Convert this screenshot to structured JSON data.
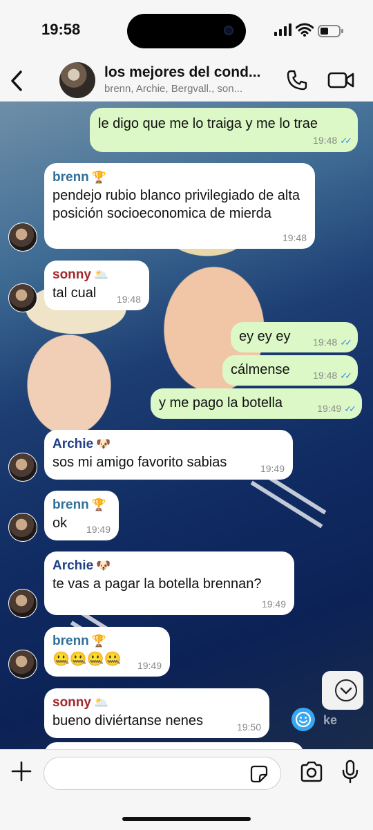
{
  "status_bar": {
    "time": "19:58"
  },
  "header": {
    "title": "los mejores del cond...",
    "subtitle": "brenn, Archie, Bergvall., son..."
  },
  "messages": [
    {
      "dir": "out",
      "text": "le digo que me lo traiga y me lo trae",
      "time": "19:48"
    },
    {
      "dir": "in",
      "sender": "brenn",
      "badge": "🏆",
      "text": "pendejo rubio blanco privilegiado de alta posición socioeconomica de mierda",
      "time": "19:48"
    },
    {
      "dir": "in",
      "sender": "sonny",
      "badge": "🌥️",
      "text": "tal cual",
      "time": "19:48"
    },
    {
      "dir": "out",
      "text": "ey ey ey",
      "time": "19:48"
    },
    {
      "dir": "out",
      "text": "cálmense",
      "time": "19:48"
    },
    {
      "dir": "out",
      "text": "y me pago la botella",
      "time": "19:49"
    },
    {
      "dir": "in",
      "sender": "Archie",
      "badge": "🐶",
      "text": "sos mi amigo favorito sabias",
      "time": "19:49"
    },
    {
      "dir": "in",
      "sender": "brenn",
      "badge": "🏆",
      "text": "ok",
      "time": "19:49"
    },
    {
      "dir": "in",
      "sender": "Archie",
      "badge": "🐶",
      "text": "te vas a pagar la botella brennan?",
      "time": "19:49"
    },
    {
      "dir": "in",
      "sender": "brenn",
      "badge": "🏆",
      "text": "🤐🤐🤐🤐",
      "time": "19:49"
    },
    {
      "dir": "in",
      "sender": "sonny",
      "badge": "🌥️",
      "text": "bueno diviértanse nenes",
      "time": "19:50"
    }
  ],
  "colors": {
    "sender_brenn": "#2f6f9a",
    "sender_sonny": "#a3262c",
    "sender_archie": "#1f3f86",
    "outgoing_bubble": "#dcf8c6",
    "read_ticks": "#3b8ee0"
  },
  "overlay": {
    "partial_label": "ke"
  },
  "input": {
    "placeholder": ""
  }
}
